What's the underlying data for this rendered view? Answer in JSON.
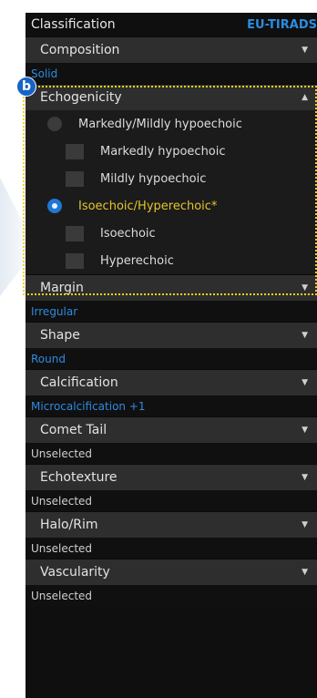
{
  "header": {
    "title": "Classification",
    "mode": "EU-TIRADS"
  },
  "badge": "b",
  "sections": [
    {
      "label": "Composition",
      "value": "Solid",
      "value_color": "blue"
    },
    {
      "label": "Echogenicity",
      "expanded": true
    },
    {
      "label": "Margin",
      "value": "Irregular",
      "value_color": "blue"
    },
    {
      "label": "Shape",
      "value": "Round",
      "value_color": "blue"
    },
    {
      "label": "Calcification",
      "value": "Microcalcification +1",
      "value_color": "blue"
    },
    {
      "label": "Comet Tail",
      "value": "Unselected",
      "value_color": "grey"
    },
    {
      "label": "Echotexture",
      "value": "Unselected",
      "value_color": "grey"
    },
    {
      "label": "Halo/Rim",
      "value": "Unselected",
      "value_color": "grey"
    },
    {
      "label": "Vascularity",
      "value": "Unselected",
      "value_color": "grey"
    }
  ],
  "echogenicity_options": [
    {
      "label": "Markedly/Mildly hypoechoic",
      "type": "radio",
      "checked": false
    },
    {
      "label": "Markedly hypoechoic",
      "type": "checkbox",
      "checked": false
    },
    {
      "label": "Mildly hypoechoic",
      "type": "checkbox",
      "checked": false
    },
    {
      "label": "Isoechoic/Hyperechoic*",
      "type": "radio",
      "checked": true
    },
    {
      "label": "Isoechoic",
      "type": "checkbox",
      "checked": false
    },
    {
      "label": "Hyperechoic",
      "type": "checkbox",
      "checked": false
    }
  ],
  "colors": {
    "accent_blue": "#2f8ae0",
    "highlight_yellow": "#e6c42a",
    "panel_bg": "#0f0f0f",
    "header_bg": "#2e2e2e"
  },
  "icons": {
    "collapsed": "chevron-down-icon",
    "expanded": "chevron-up-icon"
  }
}
